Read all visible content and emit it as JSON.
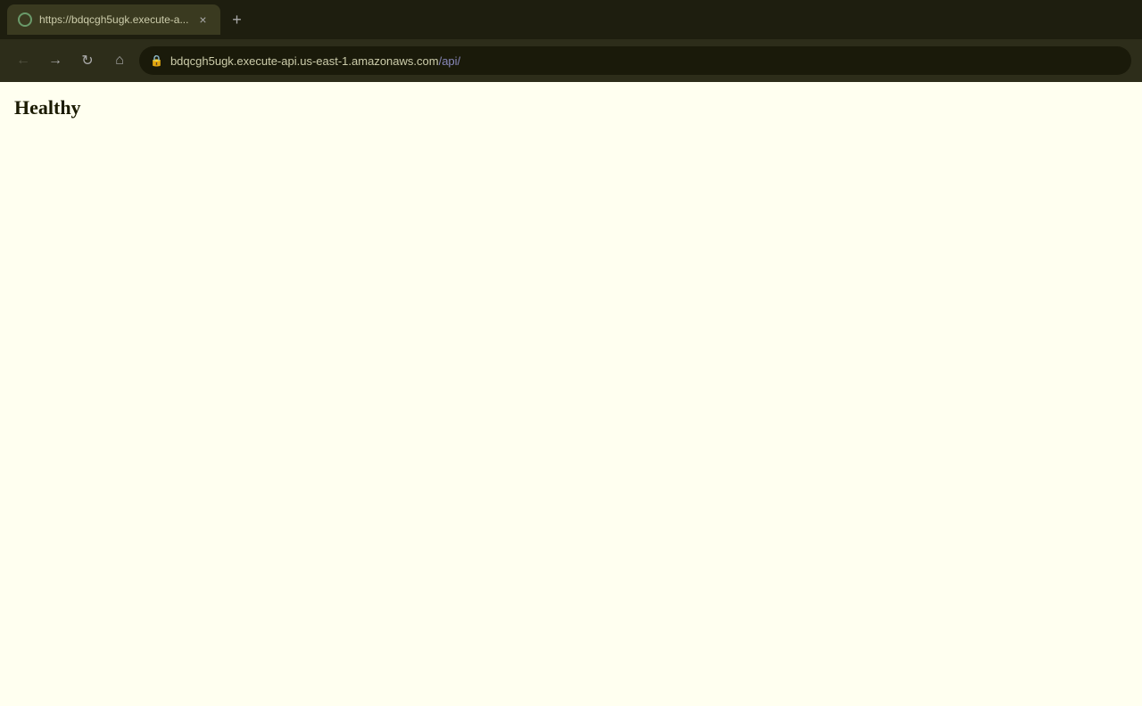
{
  "browser": {
    "tab": {
      "title": "https://bdqcgh5ugk.execute-a...",
      "close_label": "×",
      "new_tab_label": "+"
    },
    "nav": {
      "back_label": "←",
      "forward_label": "→",
      "reload_label": "↻",
      "home_label": "⌂",
      "url_base": "bdqcgh5ugk.execute-api.us-east-1.amazonaws.com",
      "url_path": "/api/",
      "full_url": "https://bdqcgh5ugk.execute-api.us-east-1.amazonaws.com/api/"
    }
  },
  "page": {
    "content": "Healthy"
  }
}
